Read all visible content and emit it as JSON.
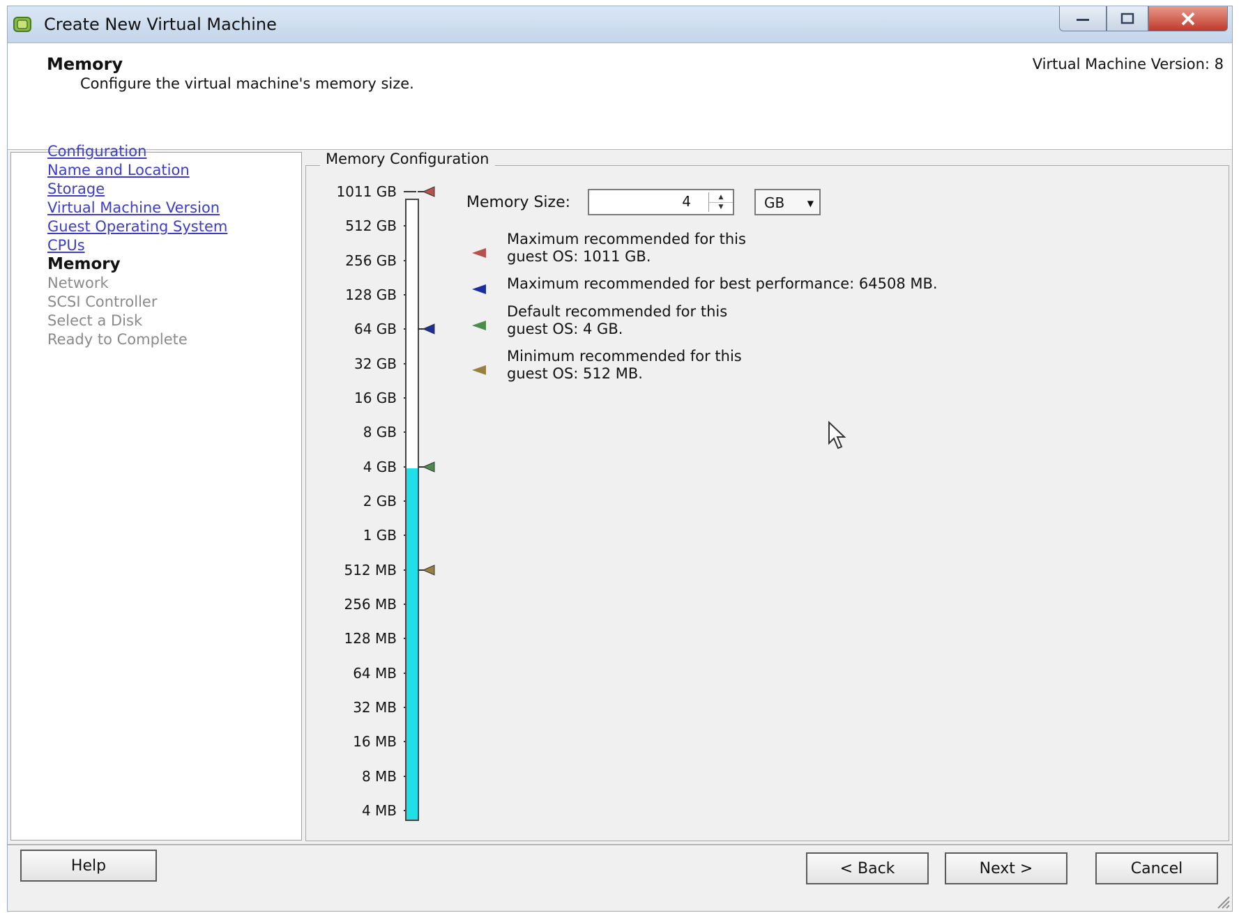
{
  "window": {
    "title": "Create New Virtual Machine",
    "controls": [
      "minimize",
      "maximize",
      "close"
    ]
  },
  "header": {
    "title": "Memory",
    "subtitle": "Configure the virtual machine's memory size.",
    "version": "Virtual Machine Version: 8"
  },
  "nav": {
    "items": [
      {
        "label": "Configuration",
        "state": "link"
      },
      {
        "label": "Name and Location",
        "state": "link"
      },
      {
        "label": "Storage",
        "state": "link"
      },
      {
        "label": "Virtual Machine Version",
        "state": "link"
      },
      {
        "label": "Guest Operating System",
        "state": "link"
      },
      {
        "label": "CPUs",
        "state": "link"
      },
      {
        "label": "Memory",
        "state": "current"
      },
      {
        "label": "Network",
        "state": "disabled"
      },
      {
        "label": "SCSI Controller",
        "state": "disabled"
      },
      {
        "label": "Select a Disk",
        "state": "disabled"
      },
      {
        "label": "Ready to Complete",
        "state": "disabled"
      }
    ]
  },
  "memory_config": {
    "group_title": "Memory Configuration",
    "size_label": "Memory Size:",
    "size_value": "4",
    "unit_value": "GB",
    "scale_ticks": [
      "1011 GB",
      "512 GB",
      "256 GB",
      "128 GB",
      "64 GB",
      "32 GB",
      "16 GB",
      "8 GB",
      "4 GB",
      "2 GB",
      "1 GB",
      "512 MB",
      "256 MB",
      "128 MB",
      "64 MB",
      "32 MB",
      "16 MB",
      "8 MB",
      "4 MB"
    ],
    "slider_value_tick_index": 8,
    "slider_markers": [
      {
        "tick_index": 0,
        "color": "#b5524a"
      },
      {
        "tick_index": 4,
        "color": "#1a2e9e"
      },
      {
        "tick_index": 8,
        "color": "#4c8c4a"
      },
      {
        "tick_index": 11,
        "color": "#9a8040"
      }
    ],
    "recommendations": [
      {
        "line1": "Maximum recommended for this",
        "line2": "guest OS: 1011 GB.",
        "color": "#b5524a"
      },
      {
        "line1": "Maximum recommended for best performance: 64508 MB.",
        "line2": "",
        "color": "#1a2e9e"
      },
      {
        "line1": "Default recommended for this",
        "line2": "guest OS: 4 GB.",
        "color": "#4c8c4a"
      },
      {
        "line1": "Minimum recommended for this",
        "line2": "guest OS: 512 MB.",
        "color": "#9a8040"
      }
    ]
  },
  "buttons": {
    "help": "Help",
    "back": "< Back",
    "next": "Next >",
    "cancel": "Cancel"
  }
}
